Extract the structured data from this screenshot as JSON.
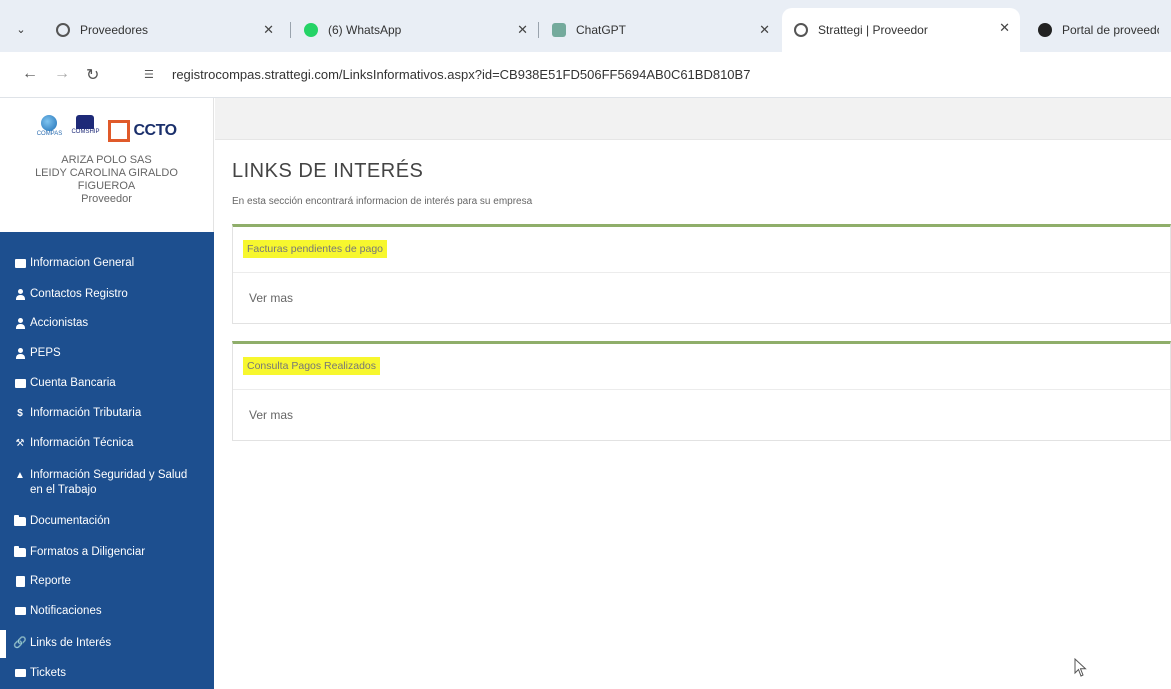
{
  "browser": {
    "tabs": [
      {
        "title": "Proveedores",
        "favicon": "globe-icon",
        "active": false
      },
      {
        "title": "(6) WhatsApp",
        "favicon": "whatsapp-icon",
        "active": false
      },
      {
        "title": "ChatGPT",
        "favicon": "chatgpt-icon",
        "active": false
      },
      {
        "title": "Strattegi | Proveedor",
        "favicon": "globe-icon",
        "active": true
      },
      {
        "title": "Portal de proveedore",
        "favicon": "portal-icon",
        "active": false
      }
    ],
    "url": "registrocompas.strattegi.com/LinksInformativos.aspx?id=CB938E51FD506FF5694AB0C61BD810B7"
  },
  "sidebar": {
    "logos": {
      "compas": "COMPAS",
      "comship": "COMSHIP",
      "ccto": "CCTO"
    },
    "user": {
      "company": "ARIZA POLO SAS",
      "name_line1": "LEIDY CAROLINA GIRALDO",
      "name_line2": "FIGUEROA",
      "role": "Proveedor"
    },
    "items": [
      {
        "label": "Informacion General",
        "icon": "id-card-icon"
      },
      {
        "label": "Contactos Registro",
        "icon": "user-icon"
      },
      {
        "label": "Accionistas",
        "icon": "user-icon"
      },
      {
        "label": "PEPS",
        "icon": "user-icon"
      },
      {
        "label": "Cuenta Bancaria",
        "icon": "credit-card-icon"
      },
      {
        "label": "Información Tributaria",
        "icon": "dollar-icon"
      },
      {
        "label": "Información Técnica",
        "icon": "wrench-icon"
      },
      {
        "label": "Información Seguridad y Salud en el Trabajo",
        "icon": "lock-icon"
      },
      {
        "label": "Documentación",
        "icon": "folder-icon"
      },
      {
        "label": "Formatos a Diligenciar",
        "icon": "folder-icon"
      },
      {
        "label": "Reporte",
        "icon": "file-icon"
      },
      {
        "label": "Notificaciones",
        "icon": "envelope-icon"
      },
      {
        "label": "Links de Interés",
        "icon": "link-icon",
        "active": true
      },
      {
        "label": "Tickets",
        "icon": "ticket-icon"
      }
    ]
  },
  "main": {
    "title": "LINKS DE INTERÉS",
    "subtitle": "En esta sección encontrará informacion de interés para su empresa",
    "cards": [
      {
        "title": "Facturas pendientes de pago",
        "link": "Ver mas"
      },
      {
        "title": "Consulta Pagos Realizados",
        "link": "Ver mas"
      }
    ]
  },
  "colors": {
    "sidebar_bg": "#1d4f8f",
    "card_accent": "#8fae6a",
    "highlight": "#f7f72e"
  }
}
